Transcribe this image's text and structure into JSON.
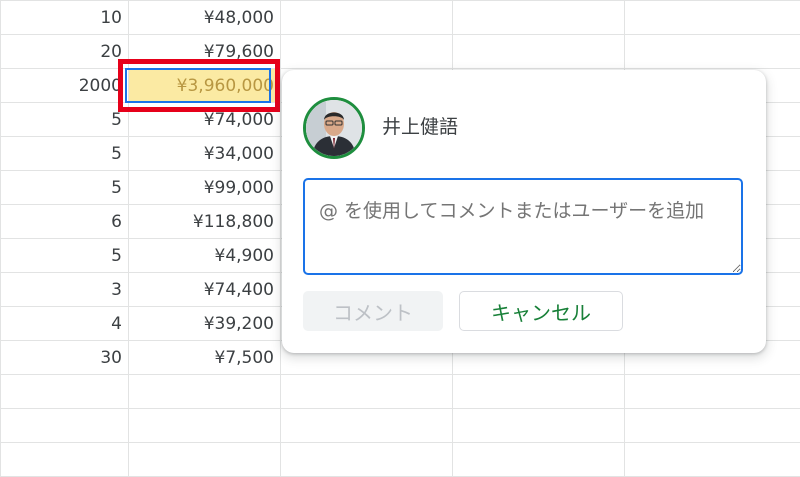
{
  "sheet": {
    "rows": [
      {
        "qty": "10",
        "amount": "¥48,000"
      },
      {
        "qty": "20",
        "amount": "¥79,600"
      },
      {
        "qty": "2000",
        "amount": "¥3,960,000"
      },
      {
        "qty": "5",
        "amount": "¥74,000"
      },
      {
        "qty": "5",
        "amount": "¥34,000"
      },
      {
        "qty": "5",
        "amount": "¥99,000"
      },
      {
        "qty": "6",
        "amount": "¥118,800"
      },
      {
        "qty": "5",
        "amount": "¥4,900"
      },
      {
        "qty": "3",
        "amount": "¥74,400"
      },
      {
        "qty": "4",
        "amount": "¥39,200"
      },
      {
        "qty": "30",
        "amount": "¥7,500"
      },
      {
        "qty": "",
        "amount": ""
      },
      {
        "qty": "",
        "amount": ""
      },
      {
        "qty": "",
        "amount": ""
      }
    ],
    "selected_row_index": 2,
    "colors": {
      "selected_fill": "#fbeaa3",
      "selection_border": "#1a73e8",
      "highlight_border": "#e6001a"
    }
  },
  "comment": {
    "user_name": "井上健語",
    "avatar_icon": "user-avatar-photo",
    "input_placeholder": "@ を使用してコメントまたはユーザーを追加",
    "submit_label": "コメント",
    "cancel_label": "キャンセル",
    "colors": {
      "accent": "#1a73e8",
      "cancel_text": "#188038",
      "avatar_ring": "#1e8e3e"
    }
  }
}
